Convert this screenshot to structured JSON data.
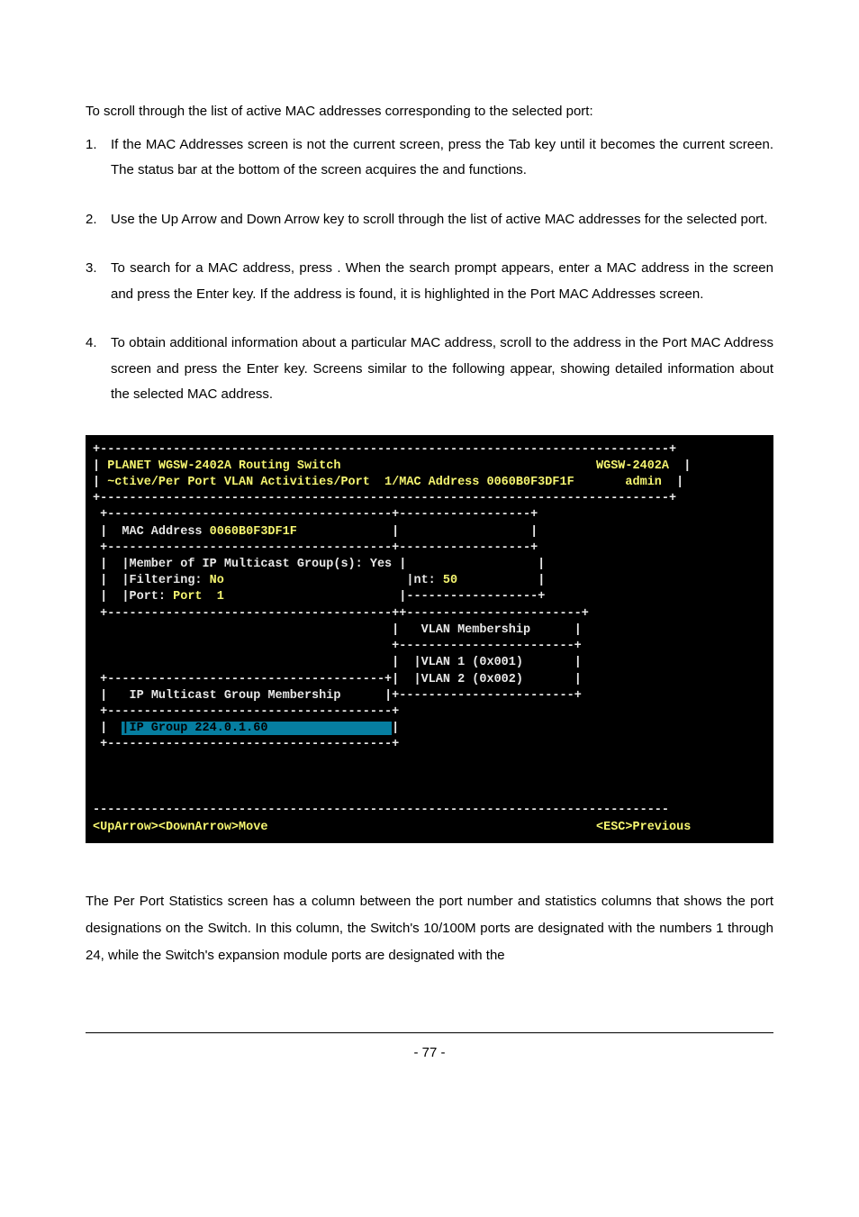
{
  "intro": "To scroll through the list of active MAC addresses corresponding to the selected port:",
  "steps": {
    "s1": {
      "num": "1.",
      "text_a": "If the MAC Addresses screen is not the current screen, press the Tab key until it becomes the current screen. The status bar at the bottom of the screen acquires the ",
      "text_b": " and ",
      "text_c": " functions."
    },
    "s2": {
      "num": "2.",
      "text": "Use the Up Arrow and Down Arrow key to scroll through the list of active MAC addresses for the selected port."
    },
    "s3": {
      "num": "3.",
      "text_a": "To search for a MAC address, press ",
      "text_b": " . When the search prompt appears, enter a MAC address in the ",
      "text_c": " screen and press the Enter key. If the address is found, it is highlighted in the Port MAC Addresses screen."
    },
    "s4": {
      "num": "4.",
      "text": "To obtain additional information about a particular MAC address, scroll to the address in the Port MAC Address screen and press the Enter key. Screens similar to the following appear, showing detailed information about the selected MAC address."
    }
  },
  "terminal": {
    "header_left_1": "PLANET WGSW-2402A Routing Switch",
    "header_right_1": "WGSW-2402A",
    "header_left_2": "~ctive/Per Port VLAN Activities/Port  1/MAC Address 0060B0F3DF1F",
    "header_right_2": "admin",
    "mac_label": "MAC Address ",
    "mac_value": "0060B0F3DF1F",
    "member_line": "|Member of IP Multicast Group(s): Yes |",
    "filter_label": "|Filtering: ",
    "filter_value": "No",
    "int_label": "|nt: ",
    "int_value": "50",
    "port_label": "|Port: ",
    "port_value": "Port  1",
    "vlan_memb": "VLAN Membership",
    "vlan1": "|VLAN 1 (0x001)",
    "vlan2": "|VLAN 2 (0x002)",
    "ip_mcast": "IP Multicast Group Membership",
    "ip_group_label": "|IP Group ",
    "ip_group_value": "224.0.1.60",
    "status_left": "<UpArrow><DownArrow>Move",
    "status_right": "<ESC>Previous"
  },
  "section_title": "",
  "body_para": "The Per Port Statistics screen has a column between the port number and statistics columns that shows the port designations on the Switch. In this column, the Switch's 10/100M ports are designated with the numbers 1 through 24, while the Switch's expansion module ports are designated with the",
  "page_number": "- 77 -"
}
